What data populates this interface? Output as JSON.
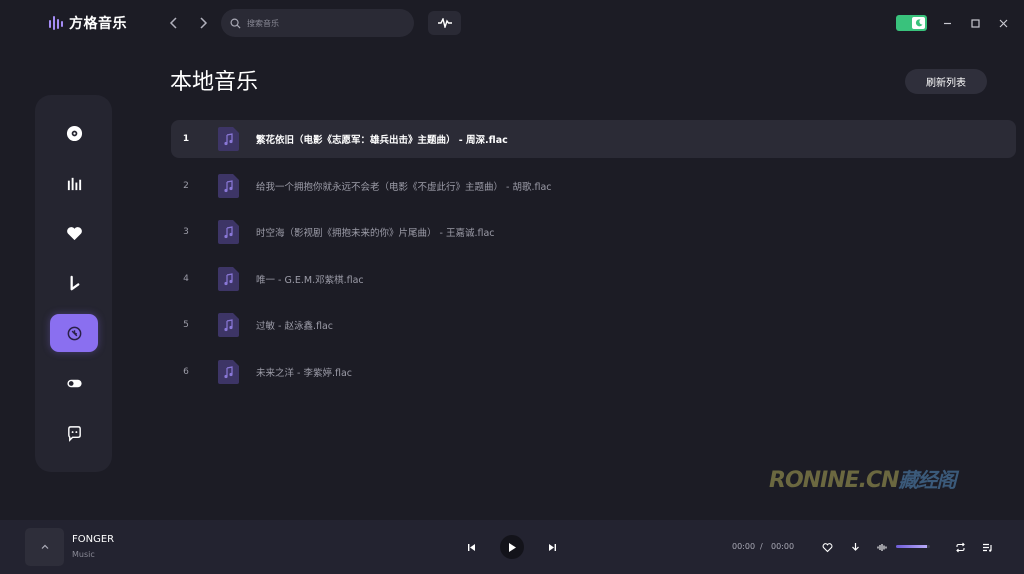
{
  "app": {
    "name": "方格音乐"
  },
  "search": {
    "placeholder": "搜索音乐"
  },
  "page": {
    "title": "本地音乐",
    "refresh_label": "刷新列表"
  },
  "sidebar": {
    "items": [
      {
        "icon": "disc-icon"
      },
      {
        "icon": "chart-bars-icon"
      },
      {
        "icon": "heart-icon"
      },
      {
        "icon": "tiktok-icon"
      },
      {
        "icon": "local-music-icon",
        "active": true
      },
      {
        "icon": "toggle-icon"
      },
      {
        "icon": "chat-icon"
      }
    ]
  },
  "tracks": [
    {
      "num": "1",
      "title": "繁花依旧（电影《志愿军：雄兵出击》主题曲） - 周深.flac",
      "active": true
    },
    {
      "num": "2",
      "title": "给我一个拥抱你就永远不会老（电影《不虚此行》主题曲） - 胡歌.flac"
    },
    {
      "num": "3",
      "title": "时空海（影视剧《拥抱未来的你》片尾曲） - 王嘉诚.flac"
    },
    {
      "num": "4",
      "title": "唯一 - G.E.M.邓紫棋.flac"
    },
    {
      "num": "5",
      "title": "过敏 - 赵泳鑫.flac"
    },
    {
      "num": "6",
      "title": "未来之洋 - 李紫婷.flac"
    }
  ],
  "watermark": {
    "part1": "RONINE.CN",
    "part2": "藏经阁"
  },
  "player": {
    "song": "FONGER",
    "artist": "Music",
    "current_time": "00:00",
    "separator": "/",
    "total_time": "00:00",
    "volume": 0.9
  },
  "colors": {
    "accent": "#8a6ff0",
    "toggle_on": "#39c27c",
    "background": "#1c1c25"
  }
}
